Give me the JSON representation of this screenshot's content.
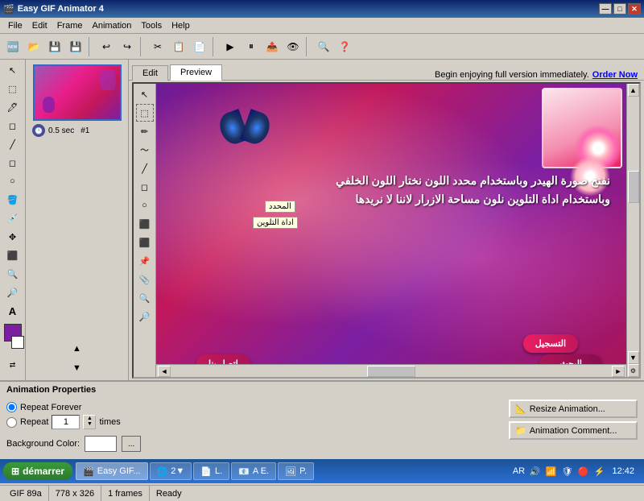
{
  "titlebar": {
    "title": "Easy GIF Animator 4",
    "buttons": {
      "minimize": "—",
      "maximize": "□",
      "close": "✕"
    }
  },
  "menu": {
    "items": [
      "File",
      "Edit",
      "Frame",
      "Animation",
      "Tools",
      "Help"
    ]
  },
  "toolbar": {
    "buttons": [
      "🆕",
      "📂",
      "💾",
      "",
      "↩",
      "↪",
      "",
      "✂",
      "📋",
      "",
      "▶",
      "⏸",
      "",
      "🔍",
      "❓"
    ]
  },
  "tabs": {
    "edit_label": "Edit",
    "preview_label": "Preview",
    "active": "Preview"
  },
  "promo": {
    "text": "Begin enjoying full version immediately.",
    "link_text": "Order Now"
  },
  "frame": {
    "time": "0.5 sec",
    "number": "#1"
  },
  "canvas": {
    "arabic_line1": "نفتح صورة الهيدر وباستخدام محدد اللون نختار اللون الخلفي",
    "arabic_line2": "وباستخدام اداة التلوين نلون مساحة الازرار لاننا لا نريدها",
    "tool_label1": "المحدد",
    "tool_label2": "اداة التلوين"
  },
  "properties": {
    "title": "Animation Properties",
    "repeat_forever_label": "Repeat Forever",
    "repeat_label": "Repeat",
    "repeat_value": "1",
    "times_label": "times",
    "bg_color_label": "Background Color:",
    "resize_btn": "Resize Animation...",
    "comment_btn": "Animation Comment..."
  },
  "status": {
    "file_info": "GIF 89a",
    "dimensions": "778 x 326",
    "frames": "1 frames",
    "state": "Ready"
  },
  "taskbar": {
    "start_label": "démarrer",
    "time": "12:42",
    "items": [
      "E.",
      "P.",
      "A E.",
      "L."
    ],
    "lang": "AR"
  }
}
